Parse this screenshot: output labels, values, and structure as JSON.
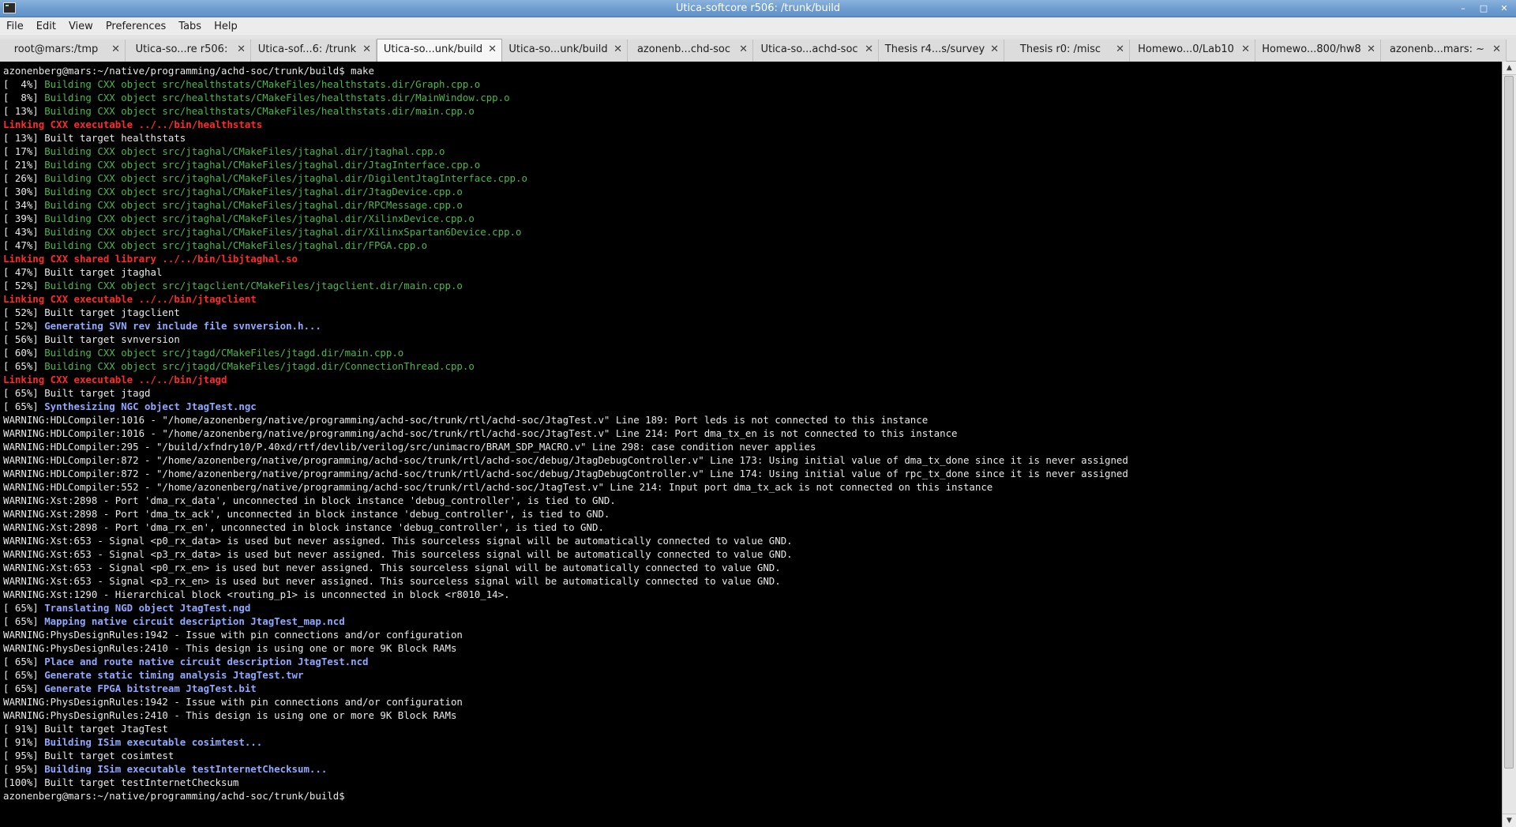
{
  "window": {
    "title": "Utica-softcore r506: /trunk/build",
    "buttons": {
      "minimize": "–",
      "maximize": "□",
      "close": "✕"
    }
  },
  "menu": [
    "File",
    "Edit",
    "View",
    "Preferences",
    "Tabs",
    "Help"
  ],
  "tabs": [
    {
      "label": "root@mars:/tmp",
      "active": false
    },
    {
      "label": "Utica-so...re r506:",
      "active": false
    },
    {
      "label": "Utica-sof...6: /trunk",
      "active": false
    },
    {
      "label": "Utica-so...unk/build",
      "active": true
    },
    {
      "label": "Utica-so...unk/build",
      "active": false
    },
    {
      "label": "azonenb...chd-soc",
      "active": false
    },
    {
      "label": "Utica-so...achd-soc",
      "active": false
    },
    {
      "label": "Thesis r4...s/survey",
      "active": false
    },
    {
      "label": "Thesis r0: /misc",
      "active": false
    },
    {
      "label": "Homewo...0/Lab10",
      "active": false
    },
    {
      "label": "Homewo...800/hw8",
      "active": false
    },
    {
      "label": "azonenb...mars: ~",
      "active": false
    }
  ],
  "tab_close_glyph": "✕",
  "scrollbar": {
    "up": "▲",
    "down": "▼",
    "thumb_fraction": 0.94
  },
  "terminal": {
    "colors": {
      "default": "#e8e8e8",
      "green": "#4cb64c",
      "red": "#ff2a2a",
      "blue": "#8fa8ff",
      "background": "#000000"
    },
    "lines": [
      [
        {
          "t": "azonenberg@mars:~/native/programming/achd-soc/trunk/build$ make",
          "c": "default"
        }
      ],
      [
        {
          "t": "[  4%] ",
          "c": "default"
        },
        {
          "t": "Building CXX object src/healthstats/CMakeFiles/healthstats.dir/Graph.cpp.o",
          "c": "green"
        }
      ],
      [
        {
          "t": "[  8%] ",
          "c": "default"
        },
        {
          "t": "Building CXX object src/healthstats/CMakeFiles/healthstats.dir/MainWindow.cpp.o",
          "c": "green"
        }
      ],
      [
        {
          "t": "[ 13%] ",
          "c": "default"
        },
        {
          "t": "Building CXX object src/healthstats/CMakeFiles/healthstats.dir/main.cpp.o",
          "c": "green"
        }
      ],
      [
        {
          "t": "Linking CXX executable ../../bin/healthstats",
          "c": "red"
        }
      ],
      [
        {
          "t": "[ 13%] Built target healthstats",
          "c": "default"
        }
      ],
      [
        {
          "t": "[ 17%] ",
          "c": "default"
        },
        {
          "t": "Building CXX object src/jtaghal/CMakeFiles/jtaghal.dir/jtaghal.cpp.o",
          "c": "green"
        }
      ],
      [
        {
          "t": "[ 21%] ",
          "c": "default"
        },
        {
          "t": "Building CXX object src/jtaghal/CMakeFiles/jtaghal.dir/JtagInterface.cpp.o",
          "c": "green"
        }
      ],
      [
        {
          "t": "[ 26%] ",
          "c": "default"
        },
        {
          "t": "Building CXX object src/jtaghal/CMakeFiles/jtaghal.dir/DigilentJtagInterface.cpp.o",
          "c": "green"
        }
      ],
      [
        {
          "t": "[ 30%] ",
          "c": "default"
        },
        {
          "t": "Building CXX object src/jtaghal/CMakeFiles/jtaghal.dir/JtagDevice.cpp.o",
          "c": "green"
        }
      ],
      [
        {
          "t": "[ 34%] ",
          "c": "default"
        },
        {
          "t": "Building CXX object src/jtaghal/CMakeFiles/jtaghal.dir/RPCMessage.cpp.o",
          "c": "green"
        }
      ],
      [
        {
          "t": "[ 39%] ",
          "c": "default"
        },
        {
          "t": "Building CXX object src/jtaghal/CMakeFiles/jtaghal.dir/XilinxDevice.cpp.o",
          "c": "green"
        }
      ],
      [
        {
          "t": "[ 43%] ",
          "c": "default"
        },
        {
          "t": "Building CXX object src/jtaghal/CMakeFiles/jtaghal.dir/XilinxSpartan6Device.cpp.o",
          "c": "green"
        }
      ],
      [
        {
          "t": "[ 47%] ",
          "c": "default"
        },
        {
          "t": "Building CXX object src/jtaghal/CMakeFiles/jtaghal.dir/FPGA.cpp.o",
          "c": "green"
        }
      ],
      [
        {
          "t": "Linking CXX shared library ../../bin/libjtaghal.so",
          "c": "red"
        }
      ],
      [
        {
          "t": "[ 47%] Built target jtaghal",
          "c": "default"
        }
      ],
      [
        {
          "t": "[ 52%] ",
          "c": "default"
        },
        {
          "t": "Building CXX object src/jtagclient/CMakeFiles/jtagclient.dir/main.cpp.o",
          "c": "green"
        }
      ],
      [
        {
          "t": "Linking CXX executable ../../bin/jtagclient",
          "c": "red"
        }
      ],
      [
        {
          "t": "[ 52%] Built target jtagclient",
          "c": "default"
        }
      ],
      [
        {
          "t": "[ 52%] ",
          "c": "default"
        },
        {
          "t": "Generating SVN rev include file svnversion.h...",
          "c": "blue"
        }
      ],
      [
        {
          "t": "[ 56%] Built target svnversion",
          "c": "default"
        }
      ],
      [
        {
          "t": "[ 60%] ",
          "c": "default"
        },
        {
          "t": "Building CXX object src/jtagd/CMakeFiles/jtagd.dir/main.cpp.o",
          "c": "green"
        }
      ],
      [
        {
          "t": "[ 65%] ",
          "c": "default"
        },
        {
          "t": "Building CXX object src/jtagd/CMakeFiles/jtagd.dir/ConnectionThread.cpp.o",
          "c": "green"
        }
      ],
      [
        {
          "t": "Linking CXX executable ../../bin/jtagd",
          "c": "red"
        }
      ],
      [
        {
          "t": "[ 65%] Built target jtagd",
          "c": "default"
        }
      ],
      [
        {
          "t": "[ 65%] ",
          "c": "default"
        },
        {
          "t": "Synthesizing NGC object JtagTest.ngc",
          "c": "blue"
        }
      ],
      [
        {
          "t": "WARNING:HDLCompiler:1016 - \"/home/azonenberg/native/programming/achd-soc/trunk/rtl/achd-soc/JtagTest.v\" Line 189: Port leds is not connected to this instance",
          "c": "default"
        }
      ],
      [
        {
          "t": "WARNING:HDLCompiler:1016 - \"/home/azonenberg/native/programming/achd-soc/trunk/rtl/achd-soc/JtagTest.v\" Line 214: Port dma_tx_en is not connected to this instance",
          "c": "default"
        }
      ],
      [
        {
          "t": "WARNING:HDLCompiler:295 - \"/build/xfndry10/P.40xd/rtf/devlib/verilog/src/unimacro/BRAM_SDP_MACRO.v\" Line 298: case condition never applies",
          "c": "default"
        }
      ],
      [
        {
          "t": "WARNING:HDLCompiler:872 - \"/home/azonenberg/native/programming/achd-soc/trunk/rtl/achd-soc/debug/JtagDebugController.v\" Line 173: Using initial value of dma_tx_done since it is never assigned",
          "c": "default"
        }
      ],
      [
        {
          "t": "WARNING:HDLCompiler:872 - \"/home/azonenberg/native/programming/achd-soc/trunk/rtl/achd-soc/debug/JtagDebugController.v\" Line 174: Using initial value of rpc_tx_done since it is never assigned",
          "c": "default"
        }
      ],
      [
        {
          "t": "WARNING:HDLCompiler:552 - \"/home/azonenberg/native/programming/achd-soc/trunk/rtl/achd-soc/JtagTest.v\" Line 214: Input port dma_tx_ack is not connected on this instance",
          "c": "default"
        }
      ],
      [
        {
          "t": "WARNING:Xst:2898 - Port 'dma_rx_data', unconnected in block instance 'debug_controller', is tied to GND.",
          "c": "default"
        }
      ],
      [
        {
          "t": "WARNING:Xst:2898 - Port 'dma_tx_ack', unconnected in block instance 'debug_controller', is tied to GND.",
          "c": "default"
        }
      ],
      [
        {
          "t": "WARNING:Xst:2898 - Port 'dma_rx_en', unconnected in block instance 'debug_controller', is tied to GND.",
          "c": "default"
        }
      ],
      [
        {
          "t": "WARNING:Xst:653 - Signal <p0_rx_data> is used but never assigned. This sourceless signal will be automatically connected to value GND.",
          "c": "default"
        }
      ],
      [
        {
          "t": "WARNING:Xst:653 - Signal <p3_rx_data> is used but never assigned. This sourceless signal will be automatically connected to value GND.",
          "c": "default"
        }
      ],
      [
        {
          "t": "WARNING:Xst:653 - Signal <p0_rx_en> is used but never assigned. This sourceless signal will be automatically connected to value GND.",
          "c": "default"
        }
      ],
      [
        {
          "t": "WARNING:Xst:653 - Signal <p3_rx_en> is used but never assigned. This sourceless signal will be automatically connected to value GND.",
          "c": "default"
        }
      ],
      [
        {
          "t": "WARNING:Xst:1290 - Hierarchical block <routing_p1> is unconnected in block <r8010_14>.",
          "c": "default"
        }
      ],
      [
        {
          "t": "[ 65%] ",
          "c": "default"
        },
        {
          "t": "Translating NGD object JtagTest.ngd",
          "c": "blue"
        }
      ],
      [
        {
          "t": "[ 65%] ",
          "c": "default"
        },
        {
          "t": "Mapping native circuit description JtagTest_map.ncd",
          "c": "blue"
        }
      ],
      [
        {
          "t": "WARNING:PhysDesignRules:1942 - Issue with pin connections and/or configuration",
          "c": "default"
        }
      ],
      [
        {
          "t": "WARNING:PhysDesignRules:2410 - This design is using one or more 9K Block RAMs",
          "c": "default"
        }
      ],
      [
        {
          "t": "[ 65%] ",
          "c": "default"
        },
        {
          "t": "Place and route native circuit description JtagTest.ncd",
          "c": "blue"
        }
      ],
      [
        {
          "t": "[ 65%] ",
          "c": "default"
        },
        {
          "t": "Generate static timing analysis JtagTest.twr",
          "c": "blue"
        }
      ],
      [
        {
          "t": "[ 65%] ",
          "c": "default"
        },
        {
          "t": "Generate FPGA bitstream JtagTest.bit",
          "c": "blue"
        }
      ],
      [
        {
          "t": "WARNING:PhysDesignRules:1942 - Issue with pin connections and/or configuration",
          "c": "default"
        }
      ],
      [
        {
          "t": "WARNING:PhysDesignRules:2410 - This design is using one or more 9K Block RAMs",
          "c": "default"
        }
      ],
      [
        {
          "t": "[ 91%] Built target JtagTest",
          "c": "default"
        }
      ],
      [
        {
          "t": "[ 91%] ",
          "c": "default"
        },
        {
          "t": "Building ISim executable cosimtest...",
          "c": "blue"
        }
      ],
      [
        {
          "t": "[ 95%] Built target cosimtest",
          "c": "default"
        }
      ],
      [
        {
          "t": "[ 95%] ",
          "c": "default"
        },
        {
          "t": "Building ISim executable testInternetChecksum...",
          "c": "blue"
        }
      ],
      [
        {
          "t": "[100%] Built target testInternetChecksum",
          "c": "default"
        }
      ],
      [
        {
          "t": "azonenberg@mars:~/native/programming/achd-soc/trunk/build$",
          "c": "default"
        }
      ]
    ]
  }
}
